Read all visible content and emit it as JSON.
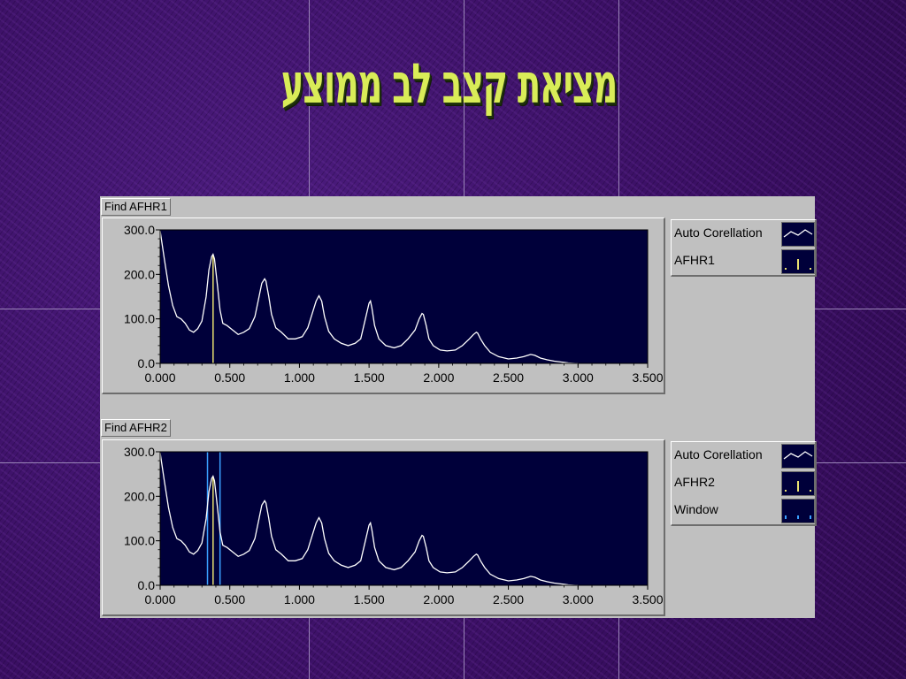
{
  "slide": {
    "title": "מציאת קצב לב ממוצע"
  },
  "colors": {
    "background": "#3a0f63",
    "title": "#d9ec58",
    "plot_bg": "#00003a",
    "curve": "#ffffff",
    "marker": "#e8e070",
    "window": "#3aa0ff",
    "panel": "#c0c0c0"
  },
  "chart_data": [
    {
      "type": "line",
      "label": "Find  AFHR1",
      "xlim": [
        0,
        3.5
      ],
      "ylim": [
        0,
        300
      ],
      "x_ticks": [
        "0.000",
        "0.500",
        "1.000",
        "1.500",
        "2.000",
        "2.500",
        "3.000",
        "3.500"
      ],
      "y_ticks": [
        "0.0",
        "100.0",
        "200.0",
        "300.0"
      ],
      "legend": [
        {
          "name": "Auto Corellation",
          "icon": "line-swatch-icon"
        },
        {
          "name": "AFHR1",
          "icon": "marker-swatch-icon"
        }
      ],
      "series": [
        {
          "name": "Auto Corellation",
          "x": [
            0.0,
            0.03,
            0.06,
            0.09,
            0.12,
            0.15,
            0.18,
            0.21,
            0.24,
            0.27,
            0.3,
            0.33,
            0.35,
            0.37,
            0.38,
            0.39,
            0.41,
            0.43,
            0.45,
            0.48,
            0.52,
            0.56,
            0.6,
            0.64,
            0.68,
            0.71,
            0.73,
            0.75,
            0.76,
            0.78,
            0.8,
            0.83,
            0.87,
            0.92,
            0.97,
            1.02,
            1.06,
            1.09,
            1.12,
            1.14,
            1.16,
            1.18,
            1.21,
            1.25,
            1.3,
            1.35,
            1.4,
            1.44,
            1.47,
            1.5,
            1.51,
            1.52,
            1.54,
            1.57,
            1.62,
            1.68,
            1.73,
            1.78,
            1.83,
            1.86,
            1.88,
            1.89,
            1.91,
            1.93,
            1.96,
            2.01,
            2.06,
            2.12,
            2.17,
            2.22,
            2.25,
            2.27,
            2.28,
            2.3,
            2.33,
            2.37,
            2.43,
            2.5,
            2.56,
            2.61,
            2.64,
            2.66,
            2.69,
            2.73,
            2.78,
            2.83,
            2.88,
            2.93,
            2.98,
            3.0
          ],
          "y": [
            298,
            235,
            175,
            130,
            105,
            100,
            90,
            75,
            70,
            78,
            95,
            150,
            210,
            240,
            245,
            235,
            180,
            120,
            90,
            85,
            75,
            65,
            70,
            78,
            105,
            150,
            180,
            190,
            185,
            150,
            110,
            80,
            70,
            55,
            55,
            60,
            80,
            110,
            140,
            152,
            140,
            105,
            72,
            55,
            45,
            40,
            45,
            55,
            95,
            135,
            140,
            125,
            85,
            55,
            40,
            35,
            40,
            55,
            75,
            100,
            112,
            110,
            85,
            55,
            40,
            30,
            28,
            30,
            40,
            55,
            65,
            70,
            68,
            55,
            40,
            25,
            15,
            10,
            12,
            15,
            18,
            20,
            18,
            12,
            8,
            5,
            3,
            1,
            0,
            0
          ]
        },
        {
          "name": "AFHR1",
          "vlines": [
            0.38
          ]
        }
      ]
    },
    {
      "type": "line",
      "label": "Find  AFHR2",
      "xlim": [
        0,
        3.5
      ],
      "ylim": [
        0,
        300
      ],
      "x_ticks": [
        "0.000",
        "0.500",
        "1.000",
        "1.500",
        "2.000",
        "2.500",
        "3.000",
        "3.500"
      ],
      "y_ticks": [
        "0.0",
        "100.0",
        "200.0",
        "300.0"
      ],
      "legend": [
        {
          "name": "Auto Corellation",
          "icon": "line-swatch-icon"
        },
        {
          "name": "AFHR2",
          "icon": "marker-swatch-icon"
        },
        {
          "name": "Window",
          "icon": "window-swatch-icon"
        }
      ],
      "series": [
        {
          "name": "Auto Corellation",
          "x": [
            0.0,
            0.03,
            0.06,
            0.09,
            0.12,
            0.15,
            0.18,
            0.21,
            0.24,
            0.27,
            0.3,
            0.33,
            0.35,
            0.37,
            0.38,
            0.39,
            0.41,
            0.43,
            0.45,
            0.48,
            0.52,
            0.56,
            0.6,
            0.64,
            0.68,
            0.71,
            0.73,
            0.75,
            0.76,
            0.78,
            0.8,
            0.83,
            0.87,
            0.92,
            0.97,
            1.02,
            1.06,
            1.09,
            1.12,
            1.14,
            1.16,
            1.18,
            1.21,
            1.25,
            1.3,
            1.35,
            1.4,
            1.44,
            1.47,
            1.5,
            1.51,
            1.52,
            1.54,
            1.57,
            1.62,
            1.68,
            1.73,
            1.78,
            1.83,
            1.86,
            1.88,
            1.89,
            1.91,
            1.93,
            1.96,
            2.01,
            2.06,
            2.12,
            2.17,
            2.22,
            2.25,
            2.27,
            2.28,
            2.3,
            2.33,
            2.37,
            2.43,
            2.5,
            2.56,
            2.61,
            2.64,
            2.66,
            2.69,
            2.73,
            2.78,
            2.83,
            2.88,
            2.93,
            2.98,
            3.0
          ],
          "y": [
            298,
            235,
            175,
            130,
            105,
            100,
            90,
            75,
            70,
            78,
            95,
            150,
            210,
            240,
            245,
            235,
            180,
            120,
            90,
            85,
            75,
            65,
            70,
            78,
            105,
            150,
            180,
            190,
            185,
            150,
            110,
            80,
            70,
            55,
            55,
            60,
            80,
            110,
            140,
            152,
            140,
            105,
            72,
            55,
            45,
            40,
            45,
            55,
            95,
            135,
            140,
            125,
            85,
            55,
            40,
            35,
            40,
            55,
            75,
            100,
            112,
            110,
            85,
            55,
            40,
            30,
            28,
            30,
            40,
            55,
            65,
            70,
            68,
            55,
            40,
            25,
            15,
            10,
            12,
            15,
            18,
            20,
            18,
            12,
            8,
            5,
            3,
            1,
            0,
            0
          ]
        },
        {
          "name": "AFHR2",
          "vlines": [
            0.38
          ]
        },
        {
          "name": "Window",
          "vlines": [
            0.34,
            0.43
          ]
        }
      ]
    }
  ]
}
